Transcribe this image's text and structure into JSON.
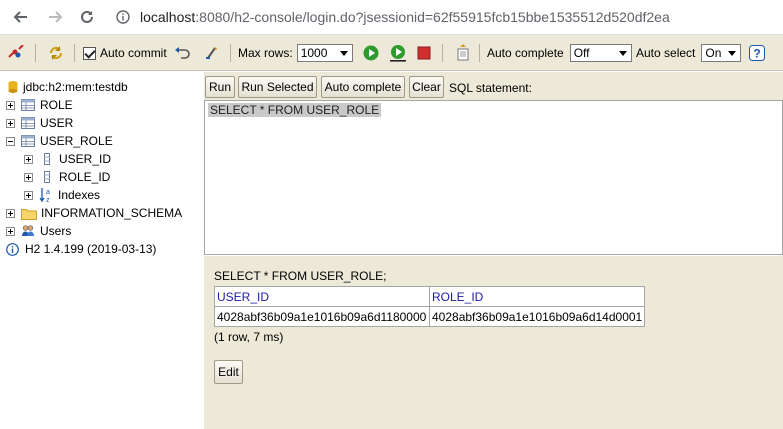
{
  "browser": {
    "url_host": "localhost",
    "url_rest": ":8080/h2-console/login.do?jsessionid=62f55915fcb15bbe1535512d520df2ea"
  },
  "toolbar": {
    "auto_commit_label": "Auto commit",
    "max_rows_label": "Max rows:",
    "max_rows_value": "1000",
    "auto_complete_label": "Auto complete",
    "auto_complete_value": "Off",
    "auto_select_label": "Auto select",
    "auto_select_value": "On"
  },
  "tree": {
    "db": "jdbc:h2:mem:testdb",
    "tables": [
      "ROLE",
      "USER",
      "USER_ROLE"
    ],
    "columns": [
      "USER_ID",
      "ROLE_ID"
    ],
    "indexes": "Indexes",
    "schema": "INFORMATION_SCHEMA",
    "users": "Users",
    "version": "H2 1.4.199 (2019-03-13)"
  },
  "query": {
    "run": "Run",
    "run_selected": "Run Selected",
    "auto_complete": "Auto complete",
    "clear": "Clear",
    "sql_label": "SQL statement:",
    "sql": "SELECT * FROM USER_ROLE"
  },
  "result": {
    "statement": "SELECT * FROM USER_ROLE;",
    "headers": [
      "USER_ID",
      "ROLE_ID"
    ],
    "rows": [
      [
        "4028abf36b09a1e1016b09a6d1180000",
        "4028abf36b09a1e1016b09a6d14d0001"
      ]
    ],
    "count": "(1 row, 7 ms)",
    "edit": "Edit"
  }
}
